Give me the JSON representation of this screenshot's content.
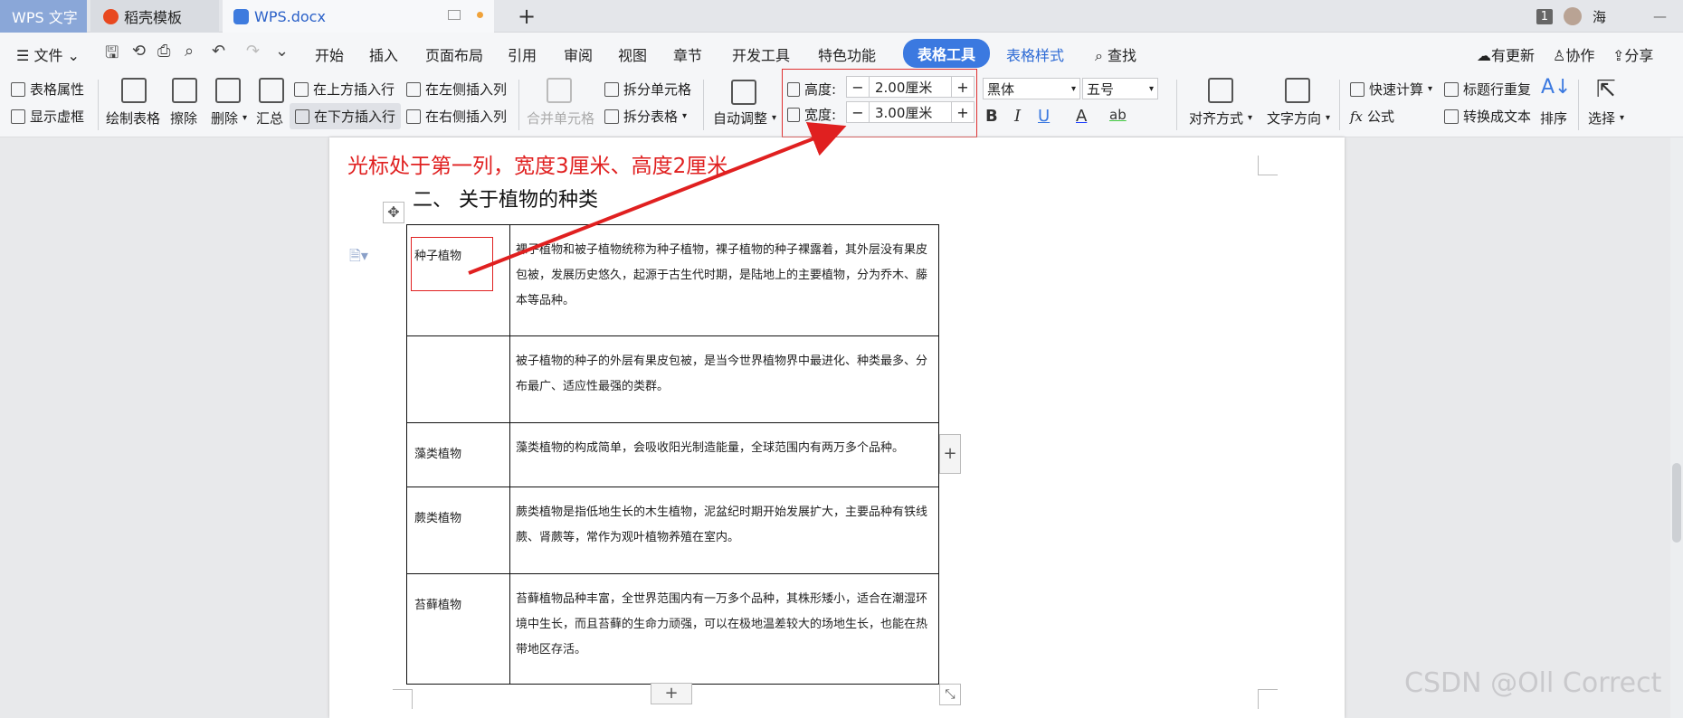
{
  "titlebar": {
    "app_tab": "WPS 文字",
    "template_tab": "稻壳模板",
    "doc_tab": "WPS.docx",
    "new_tab": "+",
    "window_count": "1",
    "user": "海",
    "minimize": "—"
  },
  "menubar": {
    "file": "文件",
    "tabs": [
      "开始",
      "插入",
      "页面布局",
      "引用",
      "审阅",
      "视图",
      "章节",
      "开发工具",
      "特色功能",
      "表格工具",
      "表格样式"
    ],
    "search": "查找",
    "update": "有更新",
    "collab": "协作",
    "share": "分享"
  },
  "ribbon": {
    "table_props": "表格属性",
    "show_gridlines": "显示虚框",
    "draw_table": "绘制表格",
    "erase": "擦除",
    "delete": "删除",
    "summary": "汇总",
    "insert_above": "在上方插入行",
    "insert_below": "在下方插入行",
    "insert_left": "在左侧插入列",
    "insert_right": "在右侧插入列",
    "merge_cells": "合并单元格",
    "split_cells": "拆分单元格",
    "split_table": "拆分表格",
    "auto_fit": "自动调整",
    "height_label": "高度:",
    "height_value": "2.00厘米",
    "width_label": "宽度:",
    "width_value": "3.00厘米",
    "font_name": "黑体",
    "font_size": "五号",
    "align": "对齐方式",
    "text_dir": "文字方向",
    "quick_calc": "快速计算",
    "formula": "公式",
    "repeat_header": "标题行重复",
    "to_text": "转换成文本",
    "sort": "排序",
    "select": "选择"
  },
  "document": {
    "annotation": "光标处于第一列，宽度3厘米、高度2厘米",
    "heading": "二、 关于植物的种类",
    "rows": [
      {
        "name": "种子植物",
        "desc": "裸子植物和被子植物统称为种子植物，裸子植物的种子裸露着，其外层没有果皮包被，发展历史悠久，起源于古生代时期，是陆地上的主要植物，分为乔木、藤本等品种。"
      },
      {
        "name": "",
        "desc": "被子植物的种子的外层有果皮包被，是当今世界植物界中最进化、种类最多、分布最广、适应性最强的类群。"
      },
      {
        "name": "藻类植物",
        "desc": "藻类植物的构成简单，会吸收阳光制造能量，全球范围内有两万多个品种。"
      },
      {
        "name": "蕨类植物",
        "desc": "蕨类植物是指低地生长的木生植物，泥盆纪时期开始发展扩大，主要品种有铁线蕨、肾蕨等，常作为观叶植物养殖在室内。"
      },
      {
        "name": "苔藓植物",
        "desc": "苔藓植物品种丰富，全世界范围内有一万多个品种，其株形矮小，适合在潮湿环境中生长，而且苔藓的生命力顽强，可以在极地温差较大的场地生长，也能在热带地区存活。"
      }
    ]
  },
  "watermark": "CSDN @Oll Correct",
  "colors": {
    "accent": "#3b79e0",
    "annotation_red": "#e02020"
  }
}
